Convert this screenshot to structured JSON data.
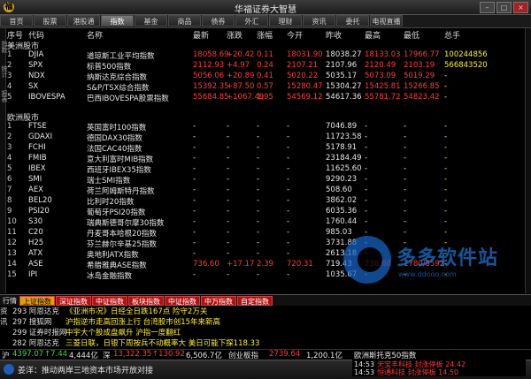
{
  "app": {
    "title": "华福证券大智慧"
  },
  "nav": [
    "首页",
    "股票",
    "港股通",
    "指数",
    "基金",
    "商品",
    "债券",
    "外汇",
    "理财",
    "资讯",
    "委托",
    "电视直播"
  ],
  "nav_active": 3,
  "side_labels": [
    "指数",
    "统计",
    "报表"
  ],
  "columns": [
    "序号",
    "代码",
    "名称",
    "最新",
    "涨跌",
    "涨幅",
    "今开",
    "昨收",
    "最高",
    "最低",
    "总手"
  ],
  "sections": {
    "america": "美洲股市",
    "europe": "欧洲股市"
  },
  "america_rows": [
    {
      "idx": "1",
      "code": "DJIA",
      "name": "道琼斯工业平均指数",
      "last": "18058.69",
      "chg": "+20.42",
      "pct": "0.11",
      "open": "18031.90",
      "prev": "18038.27",
      "high": "18133.03",
      "low": "17966.77",
      "vol": "100244856",
      "color": "red"
    },
    {
      "idx": "2",
      "code": "SPX",
      "name": "标普500指数",
      "last": "2112.93",
      "chg": "+4.97",
      "pct": "0.24",
      "open": "2107.21",
      "prev": "2107.96",
      "high": "2120.49",
      "low": "2103.19",
      "vol": "566843520",
      "color": "red"
    },
    {
      "idx": "3",
      "code": "NDX",
      "name": "纳斯达克综合指数",
      "last": "5056.06",
      "chg": "+20.89",
      "pct": "0.41",
      "open": "5020.22",
      "prev": "5035.17",
      "high": "5073.09",
      "low": "5019.29",
      "vol": "-",
      "color": "red"
    },
    {
      "idx": "4",
      "code": "SX",
      "name": "S&P/TSX综合指数",
      "last": "15392.35",
      "chg": "+87.50",
      "pct": "0.57",
      "open": "15280.47",
      "prev": "15304.27",
      "high": "15425.81",
      "low": "15266.85",
      "vol": "-",
      "color": "red"
    },
    {
      "idx": "5",
      "code": "IBOVESPA",
      "name": "巴西IBOVESPA股票指数",
      "last": "55684.85",
      "chg": "+1067.49",
      "pct": "1.95",
      "open": "54569.12",
      "prev": "54617.36",
      "high": "55781.72",
      "low": "54823.42",
      "vol": "-",
      "color": "red"
    }
  ],
  "europe_rows": [
    {
      "idx": "1",
      "code": "FTSE",
      "name": "英国富时100指数",
      "last": "-",
      "chg": "-",
      "pct": "-",
      "open": "-",
      "prev": "7046.89",
      "high": "-",
      "low": "-",
      "vol": "-",
      "color": "white"
    },
    {
      "idx": "2",
      "code": "GDAXI",
      "name": "德国DAX30指数",
      "last": "-",
      "chg": "-",
      "pct": "-",
      "open": "-",
      "prev": "11723.58",
      "high": "-",
      "low": "-",
      "vol": "-",
      "color": "white"
    },
    {
      "idx": "3",
      "code": "FCHI",
      "name": "法国CAC40指数",
      "last": "-",
      "chg": "-",
      "pct": "-",
      "open": "-",
      "prev": "5178.91",
      "high": "-",
      "low": "-",
      "vol": "-",
      "color": "white"
    },
    {
      "idx": "4",
      "code": "FMIB",
      "name": "意大利富时MIB指数",
      "last": "-",
      "chg": "-",
      "pct": "-",
      "open": "-",
      "prev": "23184.49",
      "high": "-",
      "low": "-",
      "vol": "-",
      "color": "white"
    },
    {
      "idx": "5",
      "code": "IBEX",
      "name": "西班牙IBEX35指数",
      "last": "-",
      "chg": "-",
      "pct": "-",
      "open": "-",
      "prev": "11625.60",
      "high": "-",
      "low": "-",
      "vol": "-",
      "color": "white"
    },
    {
      "idx": "6",
      "code": "SMI",
      "name": "瑞士SMI指数",
      "last": "-",
      "chg": "-",
      "pct": "-",
      "open": "-",
      "prev": "9290.23",
      "high": "-",
      "low": "-",
      "vol": "-",
      "color": "white"
    },
    {
      "idx": "7",
      "code": "AEX",
      "name": "荷兰阿姆斯特丹指数",
      "last": "-",
      "chg": "-",
      "pct": "-",
      "open": "-",
      "prev": "508.60",
      "high": "-",
      "low": "-",
      "vol": "-",
      "color": "white"
    },
    {
      "idx": "8",
      "code": "BEL20",
      "name": "比利时20指数",
      "last": "-",
      "chg": "-",
      "pct": "-",
      "open": "-",
      "prev": "3862.02",
      "high": "-",
      "low": "-",
      "vol": "-",
      "color": "white"
    },
    {
      "idx": "9",
      "code": "PSI20",
      "name": "葡萄牙PSI20指数",
      "last": "-",
      "chg": "-",
      "pct": "-",
      "open": "-",
      "prev": "6035.36",
      "high": "-",
      "low": "-",
      "vol": "-",
      "color": "white"
    },
    {
      "idx": "10",
      "code": "S30",
      "name": "瑞典斯德哥尔摩30指数",
      "last": "-",
      "chg": "-",
      "pct": "-",
      "open": "-",
      "prev": "1760.44",
      "high": "-",
      "low": "-",
      "vol": "-",
      "color": "white"
    },
    {
      "idx": "11",
      "code": "C20",
      "name": "丹麦哥本哈根20指数",
      "last": "-",
      "chg": "-",
      "pct": "-",
      "open": "-",
      "prev": "985.03",
      "high": "-",
      "low": "-",
      "vol": "-",
      "color": "white"
    },
    {
      "idx": "12",
      "code": "H25",
      "name": "芬兰赫尔辛基25指数",
      "last": "-",
      "chg": "-",
      "pct": "-",
      "open": "-",
      "prev": "3731.88",
      "high": "-",
      "low": "-",
      "vol": "-",
      "color": "white"
    },
    {
      "idx": "13",
      "code": "ATX",
      "name": "奥地利ATX指数",
      "last": "-",
      "chg": "-",
      "pct": "-",
      "open": "-",
      "prev": "2613.18",
      "high": "-",
      "low": "-",
      "vol": "-",
      "color": "white"
    },
    {
      "idx": "14",
      "code": "ASE",
      "name": "希腊雅典ASE指数",
      "last": "736.60",
      "chg": "+17.17",
      "pct": "2.39",
      "open": "720.31",
      "prev": "719.43",
      "high": "736.60",
      "low": "1780/8592",
      "vol": "-",
      "color": "red"
    },
    {
      "idx": "15",
      "code": "IPI",
      "name": "冰岛金融指数",
      "last": "-",
      "chg": "-",
      "pct": "-",
      "open": "-",
      "prev": "1035.67",
      "high": "-",
      "low": "-",
      "vol": "-",
      "color": "white"
    }
  ],
  "bottom_tabs": {
    "label": "行情",
    "tabs": [
      "上证指数",
      "深证指数",
      "中证指数",
      "板块指数",
      "中证指数",
      "中万指数",
      "自定指数"
    ],
    "active": 0
  },
  "news": [
    {
      "t": "资",
      "id": "293 阿恩达克",
      "text": "《亚洲市况》日经全日跌167点 险守2万关"
    },
    {
      "t": "讯",
      "id": "297 搜狐网",
      "text": "沪指逆市走高回涨上行 台湾股市创15年来新高"
    },
    {
      "t": "",
      "id": "299 证券时报网",
      "text": "中宇大个股成盘飙升 沪指一度翻红"
    },
    {
      "t": "",
      "id": "282 阿恩达克",
      "text": "三菱日联，日银下周按兵不动概率大 美日可能下探118.33"
    }
  ],
  "ticker": {
    "label": "沪",
    "v1": "4397.07",
    "v2": "↑7.44",
    "v3": "4,444亿",
    "label2": "深",
    "v4": "13,322.35",
    "v5": "↑130.92",
    "v6": "6,506.7亿",
    "label3": "创业板指",
    "v7": "2739.64",
    "v8": "1,200.1亿"
  },
  "status": {
    "message": "姜洋：推动两岸三地资本市场开放对接"
  },
  "popup": {
    "title": "欧洲斯托克50指数",
    "items": [
      {
        "time": "14:53",
        "text": "天宝丰科技 封涨停板 24.42"
      },
      {
        "time": "14:53",
        "text": "恒通科技 封涨停板 14.50"
      }
    ]
  },
  "watermark": {
    "text": "多多软件站",
    "url": "www.ddooo.com"
  }
}
